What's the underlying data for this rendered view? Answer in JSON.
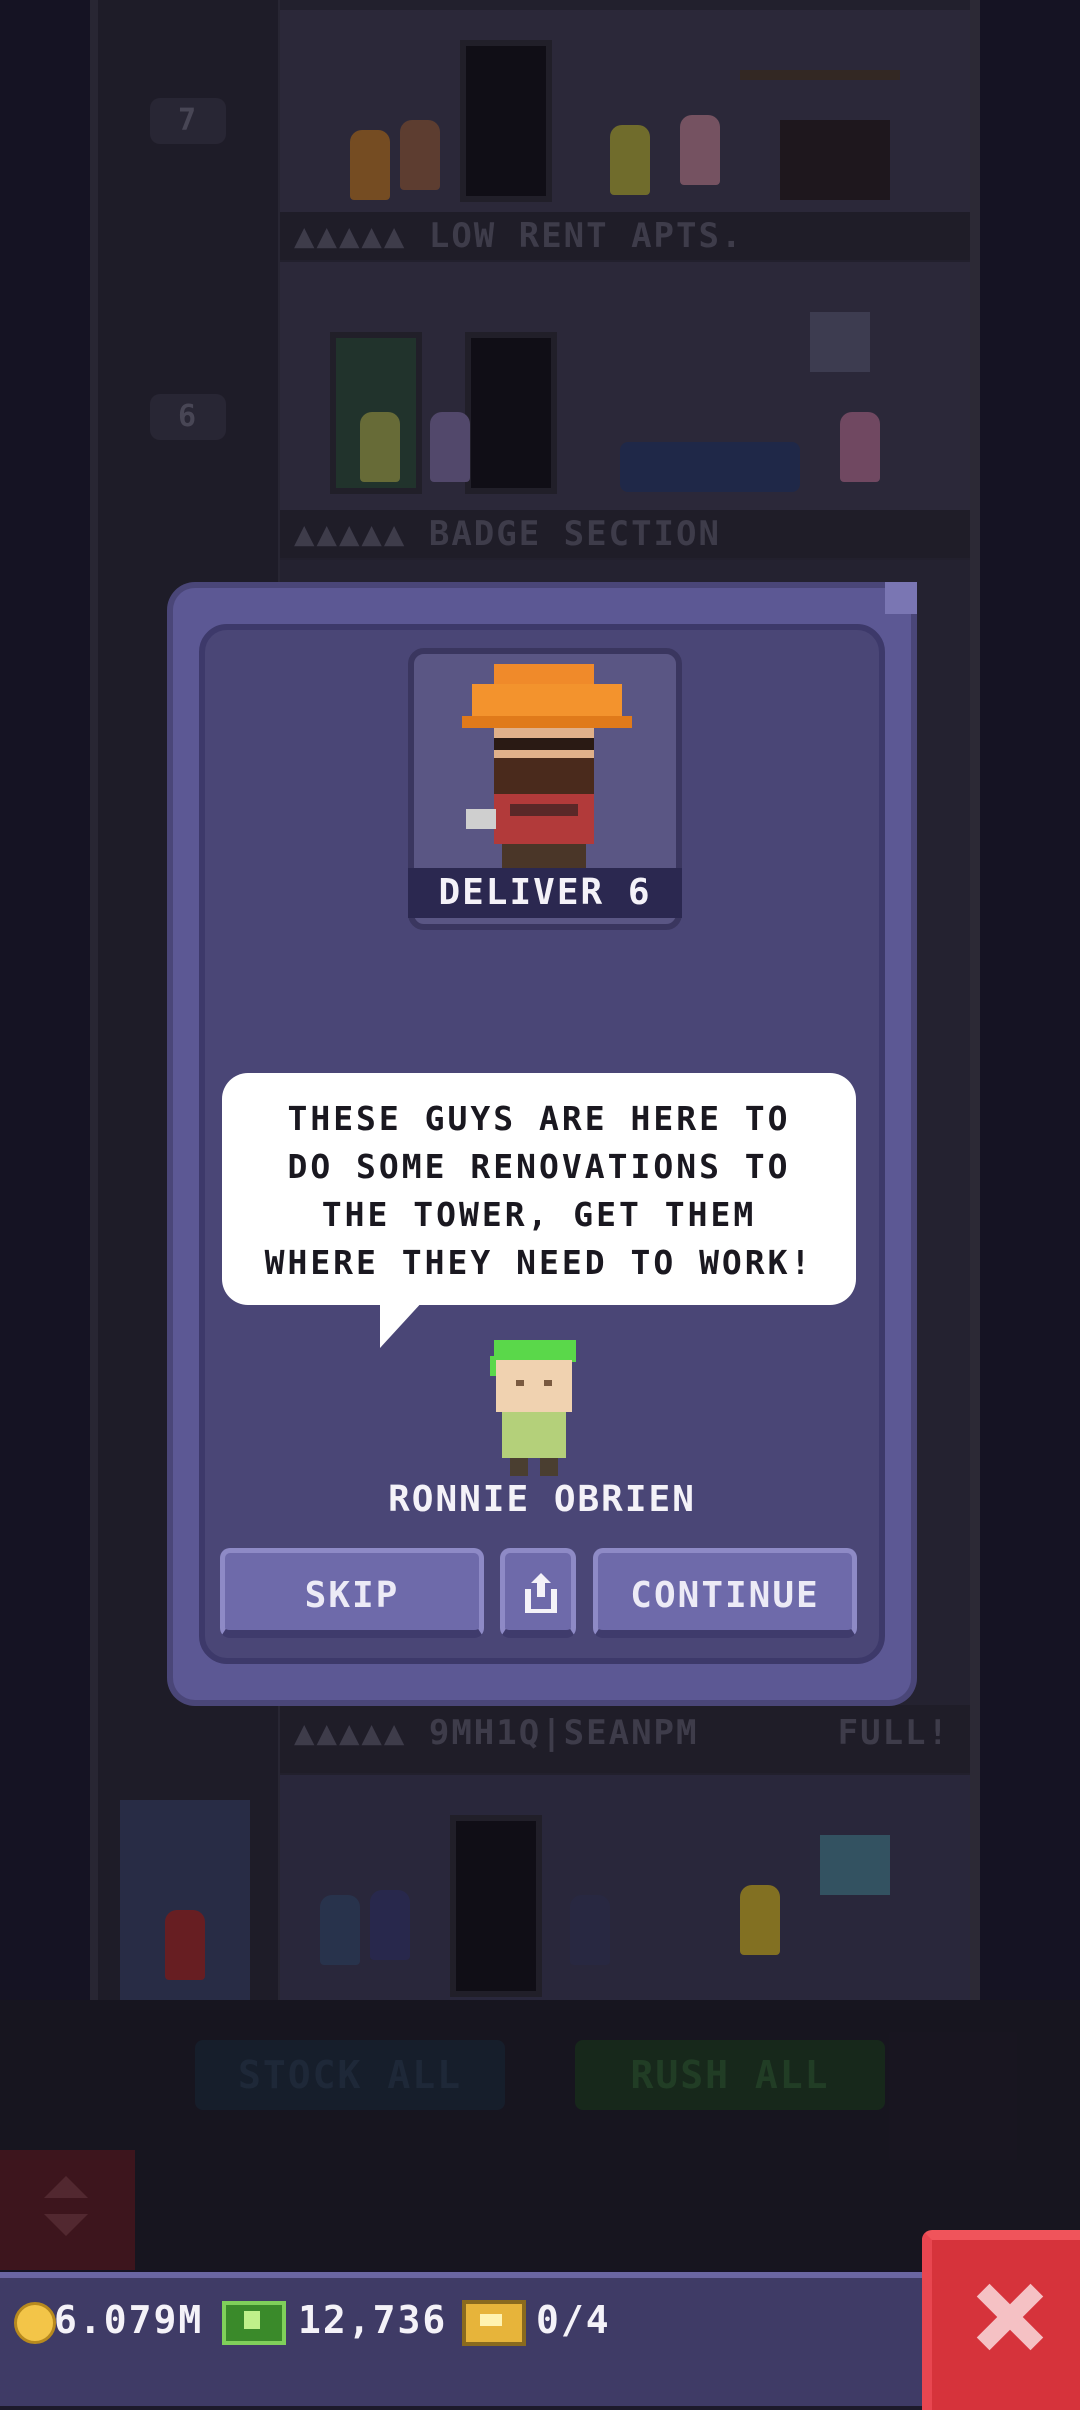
{
  "background": {
    "floors": [
      {
        "label": "LOW RENT APTS.",
        "stars": "▲▲▲▲▲",
        "elevator_floor": "7"
      },
      {
        "label": "BADGE SECTION",
        "stars": "▲▲▲▲▲",
        "elevator_floor": "6"
      },
      {
        "label": "9MH1Q|SEANPM",
        "stars": "▲▲▲▲▲",
        "status": "FULL!"
      }
    ],
    "buttons": {
      "stock_all": "STOCK ALL",
      "rush_all": "RUSH ALL"
    }
  },
  "dialog": {
    "mission_label": "DELIVER 6",
    "speech": "THESE GUYS ARE HERE TO\nDO SOME RENOVATIONS TO\nTHE TOWER, GET THEM\nWHERE THEY NEED TO WORK!",
    "npc_name": "RONNIE OBRIEN",
    "skip_label": "SKIP",
    "continue_label": "CONTINUE",
    "share_icon": "share-icon"
  },
  "status_bar": {
    "coins": "6.079M",
    "bux": "12,736",
    "tickets": "0/4",
    "coin_icon": "coin-icon",
    "bux_icon": "bux-icon",
    "ticket_icon": "ticket-icon",
    "close_icon": "close-icon"
  },
  "colors": {
    "dialog_bg": "#4a4676",
    "button_bg": "#6e6aaa",
    "close_red": "#d6333b",
    "status_bar": "#3f3b66"
  }
}
